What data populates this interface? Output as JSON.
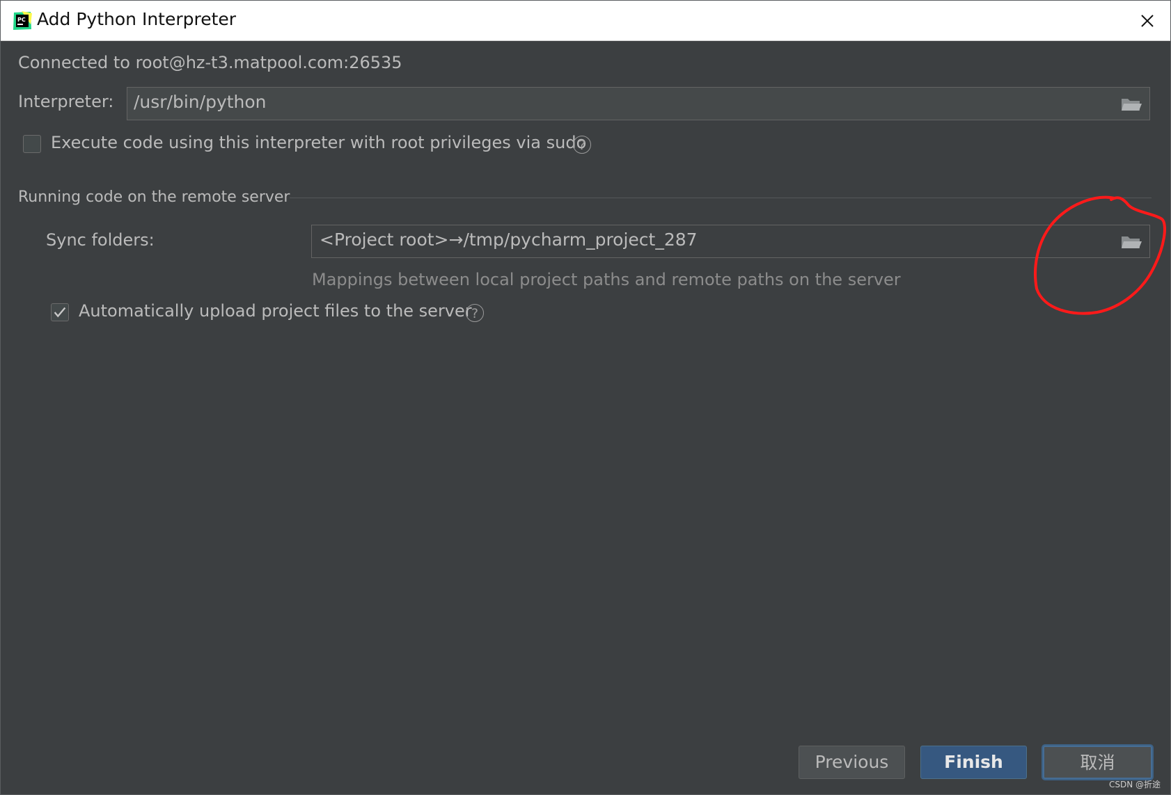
{
  "window": {
    "title": "Add Python Interpreter",
    "app_icon_text": "PC"
  },
  "connection": {
    "label": "Connected to root@hz-t3.matpool.com:26535"
  },
  "interpreter": {
    "label": "Interpreter:",
    "value": "/usr/bin/python"
  },
  "sudo": {
    "label": "Execute code using this interpreter with root privileges via sudo",
    "checked": false
  },
  "remote_section": {
    "title": "Running code on the remote server"
  },
  "sync": {
    "label": "Sync folders:",
    "value": "<Project root>→/tmp/pycharm_project_287",
    "hint": "Mappings between local project paths and remote paths on the server"
  },
  "upload": {
    "label": "Automatically upload project files to the server",
    "checked": true
  },
  "help_symbol": "?",
  "buttons": {
    "previous": "Previous",
    "finish": "Finish",
    "cancel": "取消"
  },
  "watermark": "CSDN @折途",
  "colors": {
    "background": "#3c3f41",
    "field_bg": "#45494a",
    "finish_btn": "#365880",
    "annotation": "#ff1a1a"
  }
}
